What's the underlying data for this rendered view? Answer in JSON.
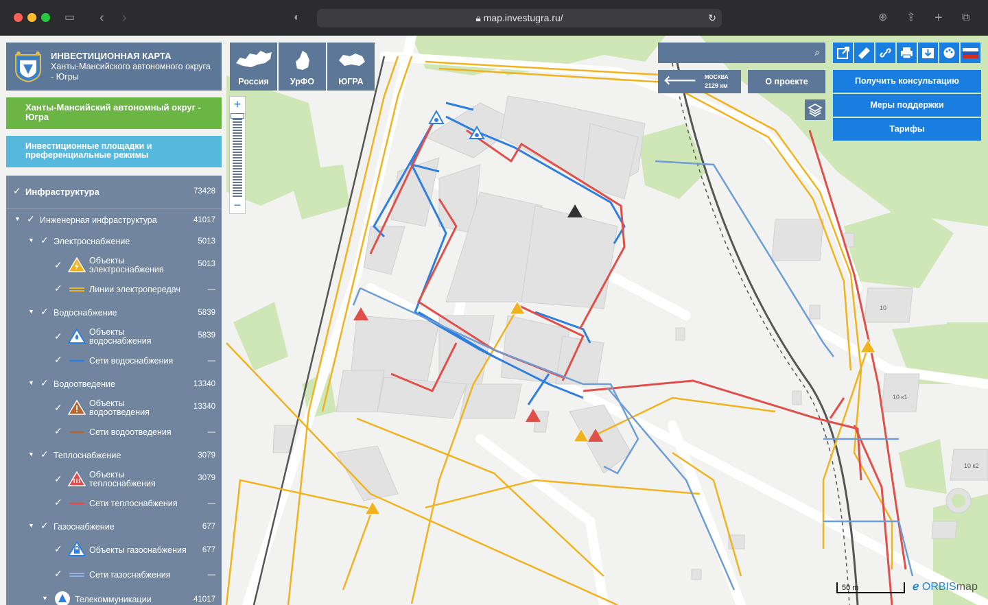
{
  "browser": {
    "url": "map.investugra.ru/"
  },
  "header": {
    "title": "ИНВЕСТИЦИОННАЯ КАРТА",
    "subtitle": "Ханты-Мансийского автономного округа - Югры"
  },
  "nav": [
    {
      "label": "Россия"
    },
    {
      "label": "УрФО"
    },
    {
      "label": "ЮГРА"
    }
  ],
  "region_button": "Ханты-Мансийский автономный округ - Югра",
  "invest_button": "Инвестиционные площадки и преференциальные режимы",
  "tree": [
    {
      "label": "Инфраструктура",
      "count": "73428",
      "level": 0,
      "bold": true
    },
    {
      "label": "Инженерная инфраструктура",
      "count": "41017",
      "level": 1
    },
    {
      "label": "Электроснабжение",
      "count": "5013",
      "level": 2
    },
    {
      "label": "Объекты электроснабжения",
      "count": "5013",
      "level": 3,
      "icon": "electric-warning-icon"
    },
    {
      "label": "Линии электропередач",
      "count": "—",
      "level": 3,
      "icon": "line-yellow-icon"
    },
    {
      "label": "Водоснабжение",
      "count": "5839",
      "level": 2
    },
    {
      "label": "Объекты водоснабжения",
      "count": "5839",
      "level": 3,
      "icon": "water-drop-icon"
    },
    {
      "label": "Сети водоснабжения",
      "count": "—",
      "level": 3,
      "icon": "line-blue-icon"
    },
    {
      "label": "Водоотведение",
      "count": "13340",
      "level": 2
    },
    {
      "label": "Объекты водоотведения",
      "count": "13340",
      "level": 3,
      "icon": "sewage-warning-icon"
    },
    {
      "label": "Сети водоотведения",
      "count": "—",
      "level": 3,
      "icon": "line-brown-icon"
    },
    {
      "label": "Теплоснабжение",
      "count": "3079",
      "level": 2
    },
    {
      "label": "Объекты теплоснабжения",
      "count": "3079",
      "level": 3,
      "icon": "heat-warning-icon"
    },
    {
      "label": "Сети теплоснабжения",
      "count": "—",
      "level": 3,
      "icon": "line-red-icon"
    },
    {
      "label": "Газоснабжение",
      "count": "677",
      "level": 2
    },
    {
      "label": "Объекты газоснабжения",
      "count": "677",
      "level": 3,
      "icon": "gas-lock-icon"
    },
    {
      "label": "Сети газоснабжения",
      "count": "—",
      "level": 3,
      "icon": "line-lightblue-icon"
    },
    {
      "label": "Телекоммуникации",
      "count": "41017",
      "level": 2,
      "icon": "telecom-icon"
    }
  ],
  "distance": {
    "city": "МОСКВА",
    "value": "2129 км"
  },
  "about_button": "О проекте",
  "action_buttons": [
    {
      "label": "Получить консультацию"
    },
    {
      "label": "Меры поддержки"
    },
    {
      "label": "Тарифы"
    }
  ],
  "scale_label": "50 m",
  "brand": {
    "orbis": "ORBIS",
    "map": "map"
  },
  "building_labels": [
    "10",
    "10 к1",
    "10 к2"
  ],
  "colors": {
    "panel": "#5d7799",
    "accent_blue": "#1a7ee0",
    "green": "#6ab544",
    "light_blue": "#56b8dd",
    "power_line": "#f0b31e",
    "water": "#2f7fe0",
    "heat": "#e0504a",
    "gas": "#6e9dd5"
  }
}
